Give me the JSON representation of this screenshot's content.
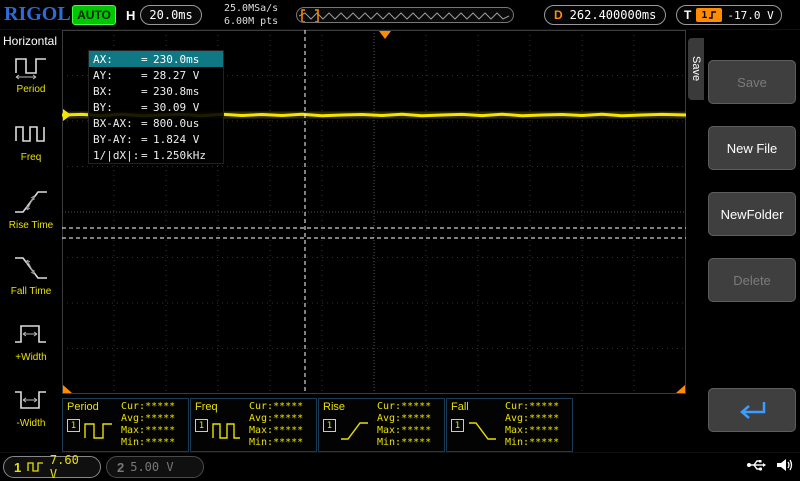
{
  "top_bar": {
    "logo": "RIGOL",
    "status": "AUTO",
    "h_label": "H",
    "timebase": "20.0ms",
    "sample_rate": "25.0MSa/s",
    "mem_depth": "6.00M pts",
    "d_label": "D",
    "delay": "262.400000ms",
    "t_label": "T",
    "trig_source": "1",
    "trig_level": "-17.0 V"
  },
  "sidebar": {
    "title": "Horizontal",
    "items": [
      "Period",
      "Freq",
      "Rise Time",
      "Fall Time",
      "+Width",
      "-Width"
    ]
  },
  "cursor_info": {
    "equals": "=",
    "rows": [
      {
        "label": "AX:",
        "value": "230.0ms"
      },
      {
        "label": "AY:",
        "value": "28.27 V"
      },
      {
        "label": "BX:",
        "value": "230.8ms"
      },
      {
        "label": "BY:",
        "value": "30.09 V"
      },
      {
        "label": "BX-AX:",
        "value": "800.0us"
      },
      {
        "label": "BY-AY:",
        "value": "1.824 V"
      },
      {
        "label": "1/|dX|:",
        "value": "1.250kHz"
      }
    ]
  },
  "right_menu": {
    "tab": "Save",
    "buttons": [
      "Save",
      "New File",
      "NewFolder",
      "Delete"
    ]
  },
  "measurements": {
    "stat_labels": [
      "Cur:",
      "Avg:",
      "Max:",
      "Min:"
    ],
    "panels": [
      {
        "name": "Period",
        "ch": "1",
        "values": [
          "*****",
          "*****",
          "*****",
          "*****"
        ]
      },
      {
        "name": "Freq",
        "ch": "1",
        "values": [
          "*****",
          "*****",
          "*****",
          "*****"
        ]
      },
      {
        "name": "Rise",
        "ch": "1",
        "values": [
          "*****",
          "*****",
          "*****",
          "*****"
        ]
      },
      {
        "name": "Fall",
        "ch": "1",
        "values": [
          "*****",
          "*****",
          "*****",
          "*****"
        ]
      }
    ]
  },
  "status_bar": {
    "ch1": {
      "num": "1",
      "scale": "7.60 V"
    },
    "ch2": {
      "num": "2",
      "scale": "5.00 V"
    }
  },
  "colors": {
    "channel1": "#e8e000",
    "trigger_orange": "#ff8c00",
    "highlight_teal": "#107884",
    "auto_green": "#00c800",
    "logo_blue": "#2e6bd6"
  },
  "icons": {
    "return_button": "return-arrow-icon",
    "usb": "usb-icon",
    "speaker": "speaker-icon"
  }
}
